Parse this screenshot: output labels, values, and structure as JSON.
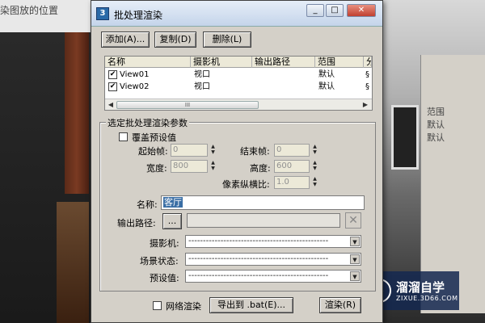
{
  "background": {
    "left_text": "染图放的位置",
    "panel_rows": [
      "范围",
      "默认",
      "默认"
    ]
  },
  "watermark": {
    "title": "溜溜自学",
    "sub": "ZIXUE.3D66.COM"
  },
  "dialog": {
    "title": "批处理渲染",
    "buttons": {
      "add": "添加(A)...",
      "copy": "复制(D)",
      "delete": "删除(L)"
    },
    "list": {
      "columns": [
        "名称",
        "摄影机",
        "输出路径",
        "范围",
        "分"
      ],
      "rows": [
        {
          "checked": true,
          "name": "View01",
          "camera": "视口",
          "output": "",
          "range": "默认",
          "extra": "§"
        },
        {
          "checked": true,
          "name": "View02",
          "camera": "视口",
          "output": "",
          "range": "默认",
          "extra": "§"
        }
      ],
      "scroll_thumb_label": "III"
    },
    "params": {
      "group_title": "选定批处理渲染参数",
      "override_label": "覆盖预设值",
      "start_frame_label": "起始帧:",
      "start_frame_value": "0",
      "end_frame_label": "结束帧:",
      "end_frame_value": "0",
      "width_label": "宽度:",
      "width_value": "800",
      "height_label": "高度:",
      "height_value": "600",
      "pixel_aspect_label": "像素纵横比:",
      "pixel_aspect_value": "1.0",
      "name_label": "名称:",
      "name_value": "客厅",
      "output_path_label": "输出路径:",
      "browse_label": "...",
      "camera_label": "摄影机:",
      "camera_value": "------------------------------------------------",
      "scene_state_label": "场景状态:",
      "scene_state_value": "------------------------------------------------",
      "preset_label": "预设值:",
      "preset_value": "------------------------------------------------"
    },
    "footer": {
      "net_render_label": "网络渲染",
      "export_label": "导出到 .bat(E)...",
      "render_label": "渲染(R)"
    }
  }
}
